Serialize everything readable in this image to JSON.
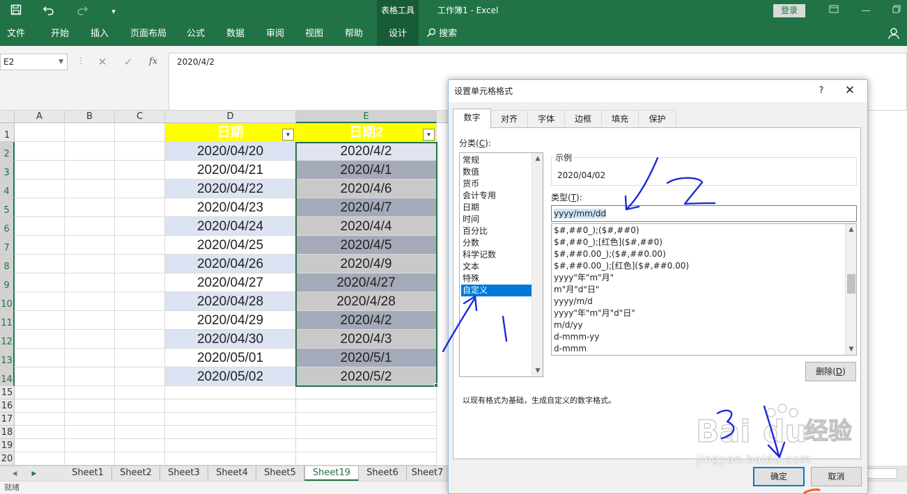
{
  "titlebar": {
    "contextual_tab": "表格工具",
    "document_title": "工作簿1  -  Excel",
    "login_label": "登录"
  },
  "ribbon": {
    "tabs": [
      "文件",
      "开始",
      "插入",
      "页面布局",
      "公式",
      "数据",
      "审阅",
      "视图",
      "帮助",
      "设计"
    ],
    "active_tab": "设计",
    "search_label": "搜索"
  },
  "formula_bar": {
    "name_box": "E2",
    "cancel_icon": "✕",
    "enter_icon": "✓",
    "fx_label": "fx",
    "formula_value": "2020/4/2"
  },
  "sheet": {
    "columns": [
      "A",
      "B",
      "C",
      "D",
      "E"
    ],
    "rows": [
      "1",
      "2",
      "3",
      "4",
      "5",
      "6",
      "7",
      "8",
      "9",
      "10",
      "11",
      "12",
      "13",
      "14",
      "15",
      "16",
      "17",
      "18",
      "19",
      "20"
    ],
    "header_d": "日期",
    "header_e": "日期2",
    "col_d_values": [
      "2020/04/20",
      "2020/04/21",
      "2020/04/22",
      "2020/04/23",
      "2020/04/24",
      "2020/04/25",
      "2020/04/26",
      "2020/04/27",
      "2020/04/28",
      "2020/04/29",
      "2020/04/30",
      "2020/05/01",
      "2020/05/02"
    ],
    "col_e_values": [
      "2020/4/2",
      "2020/4/1",
      "2020/4/6",
      "2020/4/7",
      "2020/4/4",
      "2020/4/5",
      "2020/4/9",
      "2020/4/27",
      "2020/4/28",
      "2020/4/2",
      "2020/4/3",
      "2020/5/1",
      "2020/5/2"
    ]
  },
  "sheet_tabs": {
    "tabs": [
      "Sheet1",
      "Sheet2",
      "Sheet3",
      "Sheet4",
      "Sheet5",
      "Sheet19",
      "Sheet6",
      "Sheet7"
    ],
    "active": "Sheet19"
  },
  "statusbar": {
    "text": "就绪"
  },
  "dialog": {
    "title": "设置单元格格式",
    "help_label": "?",
    "close_label": "✕",
    "tabs": [
      "数字",
      "对齐",
      "字体",
      "边框",
      "填充",
      "保护"
    ],
    "active_tab": "数字",
    "category_label": "分类(",
    "category_key": "C",
    "category_label_end": "):",
    "categories": [
      "常规",
      "数值",
      "货币",
      "会计专用",
      "日期",
      "时间",
      "百分比",
      "分数",
      "科学记数",
      "文本",
      "特殊",
      "自定义"
    ],
    "selected_category": "自定义",
    "sample_label": "示例",
    "sample_value": "2020/04/02",
    "type_label": "类型(",
    "type_key": "T",
    "type_label_end": "):",
    "type_value": "yyyy/mm/dd",
    "formats": [
      "$#,##0_);($#,##0)",
      "$#,##0_);[红色]($#,##0)",
      "$#,##0.00_);($#,##0.00)",
      "$#,##0.00_);[红色]($#,##0.00)",
      "yyyy\"年\"m\"月\"",
      "m\"月\"d\"日\"",
      "yyyy/m/d",
      "yyyy\"年\"m\"月\"d\"日\"",
      "m/d/yy",
      "d-mmm-yy",
      "d-mmm"
    ],
    "delete_label": "删除(",
    "delete_key": "D",
    "delete_label_end": ")",
    "hint": "以现有格式为基础，生成自定义的数字格式。",
    "ok_label": "确定",
    "cancel_label": "取消"
  },
  "watermark": {
    "text": "jingyan.baidu.com"
  },
  "colors": {
    "excel_green": "#217346",
    "header_fill": "#ffff00",
    "band_d": "#dce3f2",
    "band_e_light": "#c9c9c9",
    "band_e_dark": "#a4aab9",
    "selection_blue": "#0078d7",
    "annotation_ink": "#1a2ad8"
  }
}
